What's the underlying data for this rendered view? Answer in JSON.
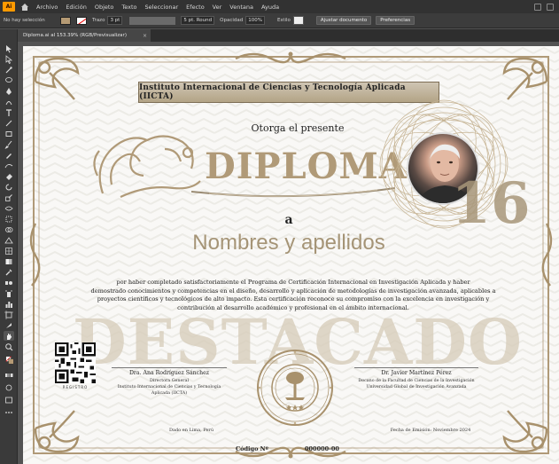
{
  "app": {
    "logo": "Ai",
    "menu": [
      "Archivo",
      "Edición",
      "Objeto",
      "Texto",
      "Seleccionar",
      "Efecto",
      "Ver",
      "Ventana",
      "Ayuda"
    ]
  },
  "control_bar": {
    "selection": "No hay selección",
    "stroke_label": "Trazo",
    "stroke_value": "3 pt",
    "brush": "5 pt. Round",
    "opacity_label": "Opacidad",
    "opacity_value": "100%",
    "style_label": "Estilo",
    "doc_setup": "Ajustar documento",
    "preferences": "Preferencias",
    "fill_color": "#b59a74"
  },
  "tab": {
    "title": "Diploma.ai al 153.39% (RGB/Previsualizar)",
    "close": "×"
  },
  "certificate": {
    "institute": "Instituto Internacional de Ciencias y Tecnología Aplicada (IICTA)",
    "grants": "Otorga el presente",
    "title": "DIPLOMA",
    "to": "a",
    "recipient": "Nombres y apellidos",
    "body_1": "por haber completado satisfactoriamente el Programa de Certificación Internacional en Investigación Aplicada y haber",
    "body_2": "demostrado conocimientos y competencias en el diseño, desarrollo y aplicación de metodologías de investigación avanzada, aplicables a",
    "body_3": "proyectos científicos y tecnológicos de alto impacto. Esta certificación reconoce su compromiso con la excelencia en investigación y",
    "body_4": "contribución al desarrollo académico y profesional en el ámbito internacional.",
    "watermark": "DESTACADO",
    "number": "16",
    "signer_left_name": "Dra. Ana Rodríguez Sánchez",
    "signer_left_role_1": "Directora General",
    "signer_left_role_2": "Instituto Internacional de Ciencias y Tecnología",
    "signer_left_role_3": "Aplicada (IICTA)",
    "signer_right_name": "Dr. Javier Martínez Pérez",
    "signer_right_role_1": "Decano de la Facultad de Ciencias de la Investigación",
    "signer_right_role_2": "Universidad Global de Investigación Avanzada",
    "place": "Dado en Lima, Perú",
    "emission": "Fecha de Emisión: Noviembre 2024",
    "code_label": "Código Nº",
    "code_value": "000000-00",
    "registro": "REGISTRO"
  },
  "colors": {
    "gold": "#b09a78",
    "gold_dark": "#8c7757",
    "watermark": "#d6cbb8"
  }
}
